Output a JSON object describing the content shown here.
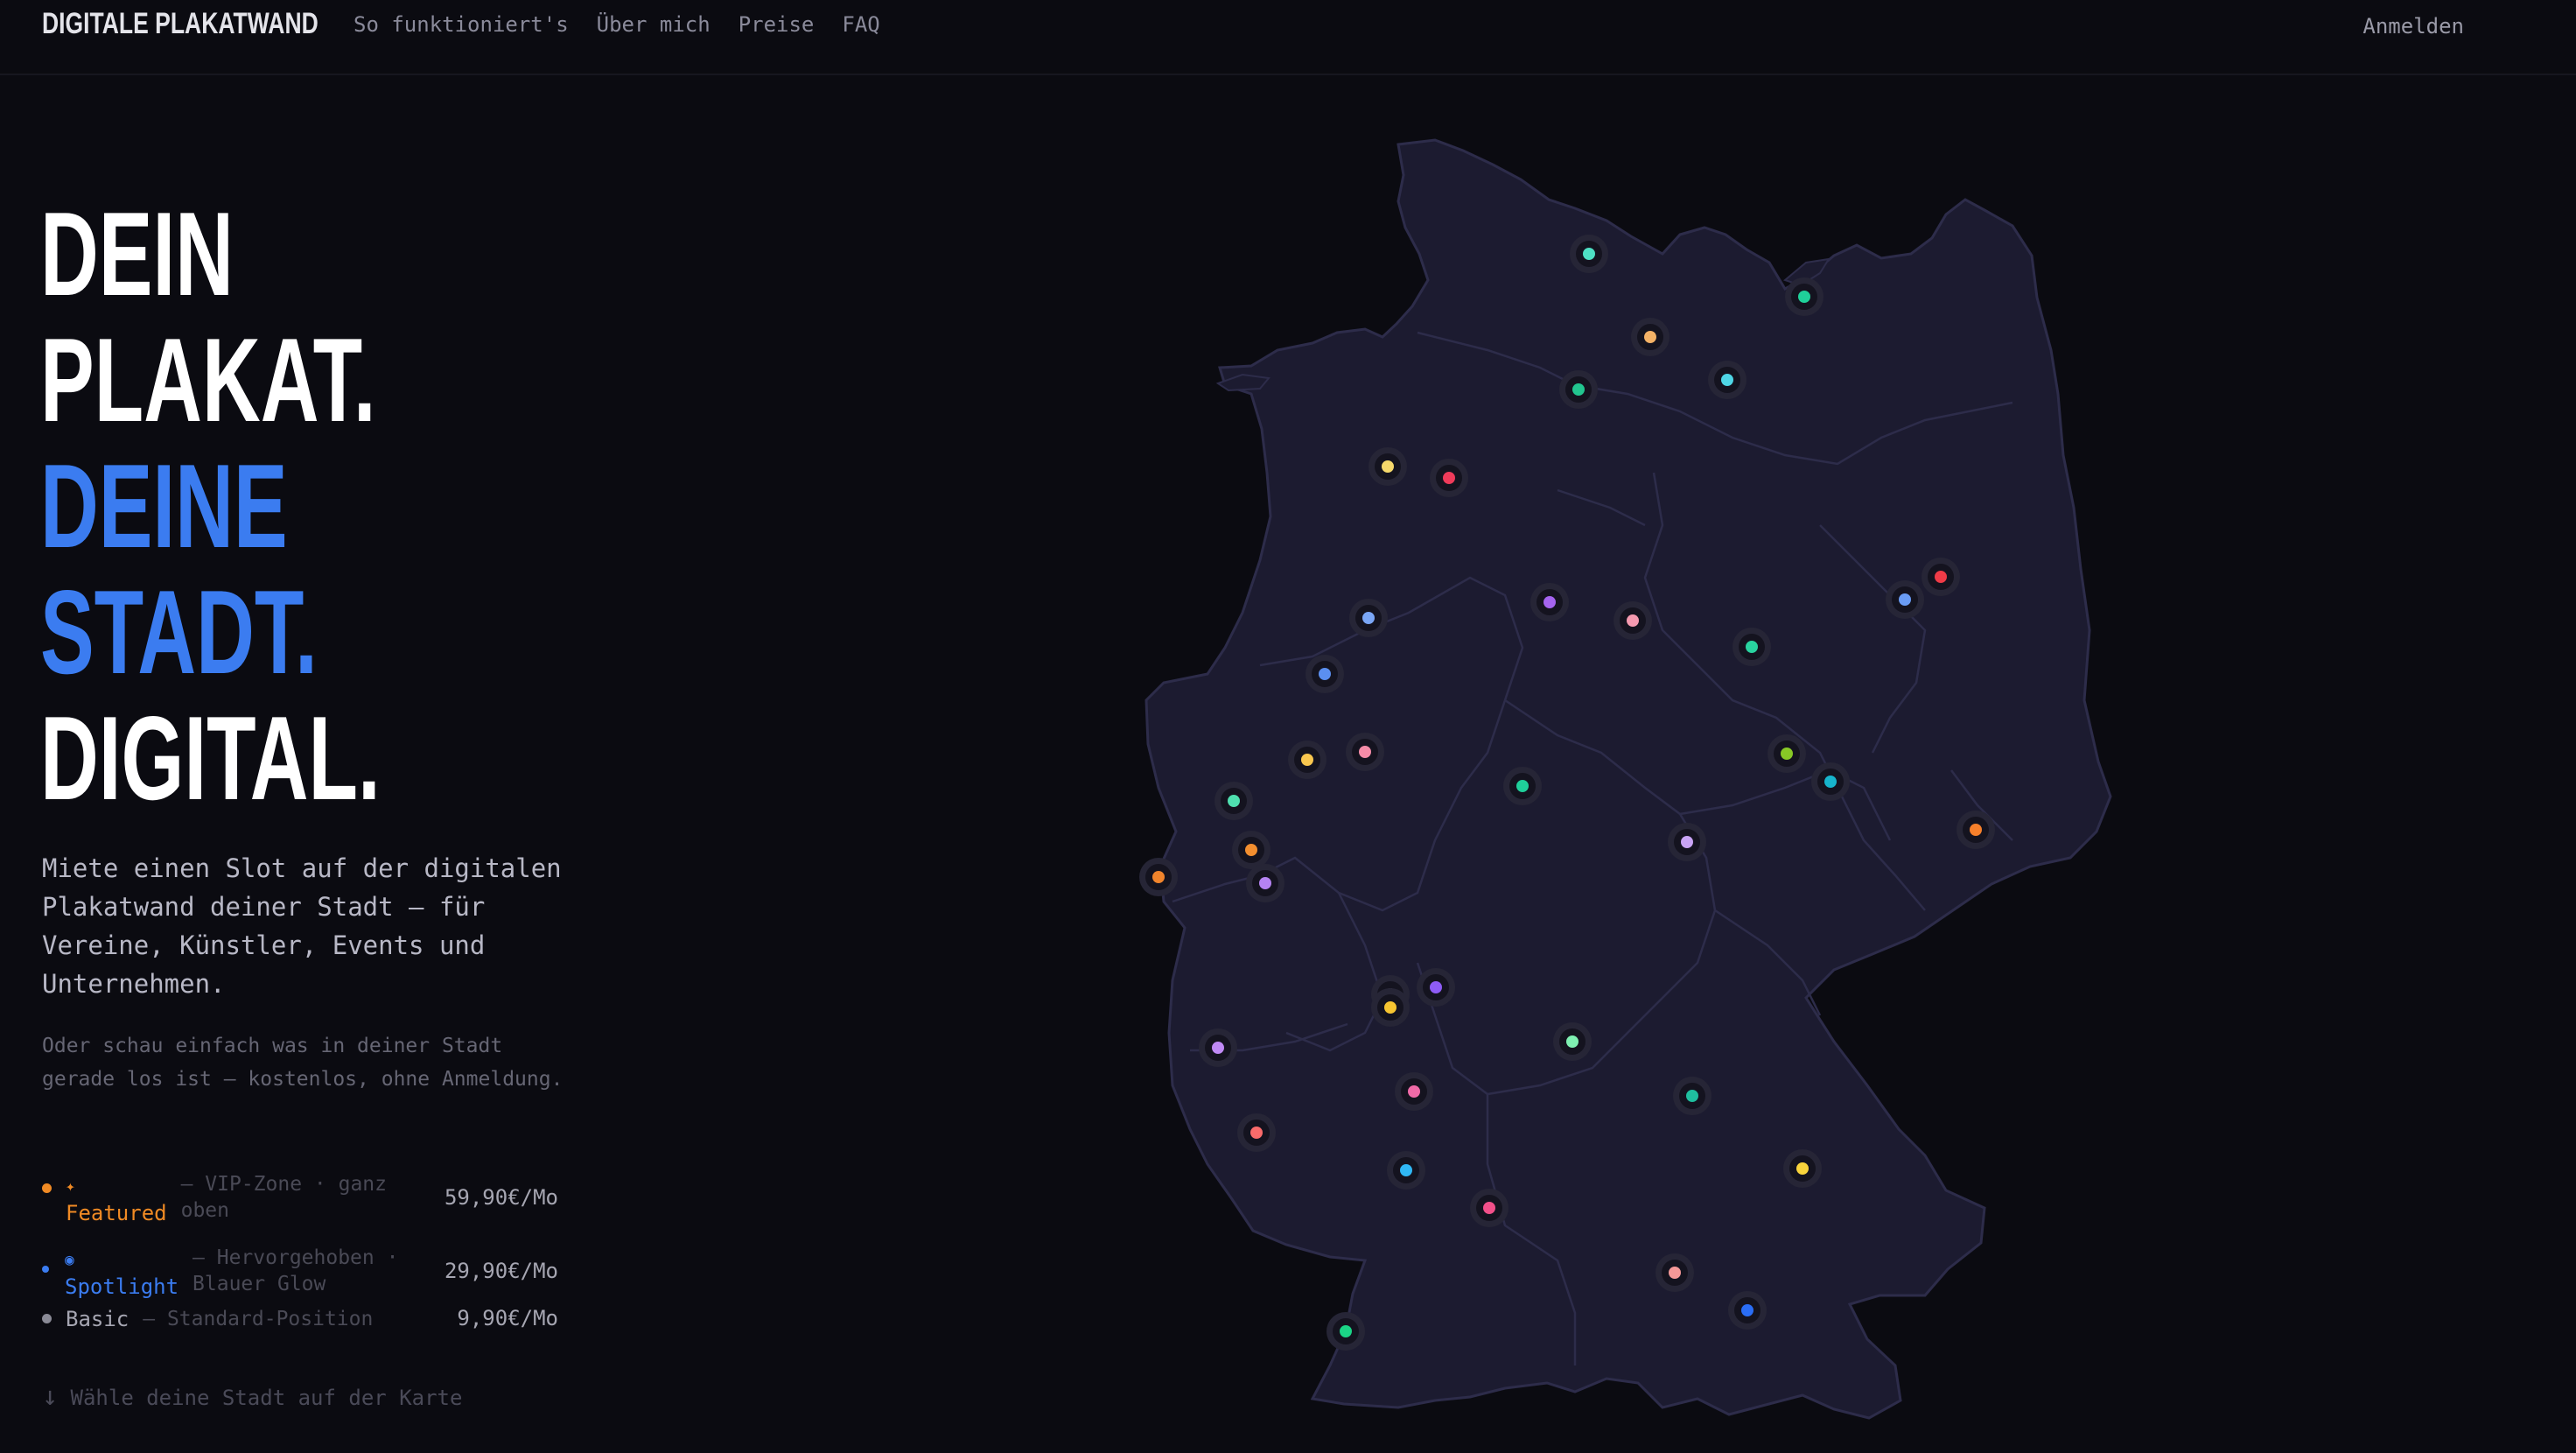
{
  "brand": "DIGITALE PLAKATWAND",
  "nav": [
    "So funktioniert's",
    "Über mich",
    "Preise",
    "FAQ"
  ],
  "login": "Anmelden",
  "headline": {
    "line1": "DEIN",
    "line2": "PLAKAT.",
    "line3": "DEINE",
    "line4": "STADT.",
    "line5": "DIGITAL."
  },
  "lead": "Miete einen Slot auf der digitalen Plakatwand deiner Stadt — für Vereine, Künstler, Events und Unternehmen.",
  "sub": "Oder schau einfach was in deiner Stadt gerade los ist — kostenlos, ohne Anmeldung.",
  "tiers": [
    {
      "icon": "✦",
      "name": "Featured",
      "desc": "— VIP-Zone · ganz oben",
      "price": "59,90€/Mo",
      "color": "#f08a24"
    },
    {
      "icon": "◉",
      "name": "Spotlight",
      "desc": "— Hervorgehoben · Blauer Glow",
      "price": "29,90€/Mo",
      "color": "#3b7cf0"
    },
    {
      "icon": "",
      "name": "Basic",
      "desc": "— Standard-Position",
      "price": "9,90€/Mo",
      "color": "#8a8a96"
    }
  ],
  "hint_arrow": "↓",
  "hint": "Wähle deine Stadt auf der Karte",
  "map_colors": {
    "land": "#1c1b30",
    "border": "#2d2c4a",
    "background": "#0b0b11"
  },
  "city_pins": [
    {
      "color": "#4ee0c4"
    },
    {
      "color": "#1fd19a"
    },
    {
      "color": "#f4b266"
    },
    {
      "color": "#22c58f"
    },
    {
      "color": "#4fd6e6"
    },
    {
      "color": "#f5d86b"
    },
    {
      "color": "#ef3b5a"
    },
    {
      "color": "#ef3b47"
    },
    {
      "color": "#6a9cf5"
    },
    {
      "color": "#a564ef"
    },
    {
      "color": "#f59ab0"
    },
    {
      "color": "#7aa6f5"
    },
    {
      "color": "#29d3a0"
    },
    {
      "color": "#5b8ff0"
    },
    {
      "color": "#1fcf9a"
    },
    {
      "color": "#f9c74f"
    },
    {
      "color": "#f58ca8"
    },
    {
      "color": "#88c826"
    },
    {
      "color": "#17b4cc"
    },
    {
      "color": "#4fe0b0"
    },
    {
      "color": "#f38f2f"
    },
    {
      "color": "#c9a4f5"
    },
    {
      "color": "#f0842c"
    },
    {
      "color": "#f7802b"
    },
    {
      "color": "#b583f2"
    },
    {
      "color": "#777777"
    },
    {
      "color": "#f7c531"
    },
    {
      "color": "#8e5cf5"
    },
    {
      "color": "#7ff0b2"
    },
    {
      "color": "#c08af5"
    },
    {
      "color": "#f06aa8"
    },
    {
      "color": "#1fbf9f"
    },
    {
      "color": "#fa6b6b"
    },
    {
      "color": "#30b8f5"
    },
    {
      "color": "#f2508a"
    },
    {
      "color": "#f9d43c"
    },
    {
      "color": "#f59898"
    },
    {
      "color": "#2a6df5"
    },
    {
      "color": "#1bd486"
    }
  ]
}
